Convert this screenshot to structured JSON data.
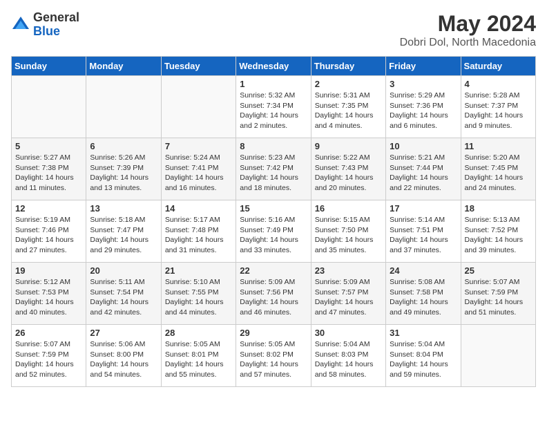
{
  "header": {
    "logo_general": "General",
    "logo_blue": "Blue",
    "month": "May 2024",
    "location": "Dobri Dol, North Macedonia"
  },
  "weekdays": [
    "Sunday",
    "Monday",
    "Tuesday",
    "Wednesday",
    "Thursday",
    "Friday",
    "Saturday"
  ],
  "weeks": [
    [
      {
        "day": "",
        "info": ""
      },
      {
        "day": "",
        "info": ""
      },
      {
        "day": "",
        "info": ""
      },
      {
        "day": "1",
        "info": "Sunrise: 5:32 AM\nSunset: 7:34 PM\nDaylight: 14 hours\nand 2 minutes."
      },
      {
        "day": "2",
        "info": "Sunrise: 5:31 AM\nSunset: 7:35 PM\nDaylight: 14 hours\nand 4 minutes."
      },
      {
        "day": "3",
        "info": "Sunrise: 5:29 AM\nSunset: 7:36 PM\nDaylight: 14 hours\nand 6 minutes."
      },
      {
        "day": "4",
        "info": "Sunrise: 5:28 AM\nSunset: 7:37 PM\nDaylight: 14 hours\nand 9 minutes."
      }
    ],
    [
      {
        "day": "5",
        "info": "Sunrise: 5:27 AM\nSunset: 7:38 PM\nDaylight: 14 hours\nand 11 minutes."
      },
      {
        "day": "6",
        "info": "Sunrise: 5:26 AM\nSunset: 7:39 PM\nDaylight: 14 hours\nand 13 minutes."
      },
      {
        "day": "7",
        "info": "Sunrise: 5:24 AM\nSunset: 7:41 PM\nDaylight: 14 hours\nand 16 minutes."
      },
      {
        "day": "8",
        "info": "Sunrise: 5:23 AM\nSunset: 7:42 PM\nDaylight: 14 hours\nand 18 minutes."
      },
      {
        "day": "9",
        "info": "Sunrise: 5:22 AM\nSunset: 7:43 PM\nDaylight: 14 hours\nand 20 minutes."
      },
      {
        "day": "10",
        "info": "Sunrise: 5:21 AM\nSunset: 7:44 PM\nDaylight: 14 hours\nand 22 minutes."
      },
      {
        "day": "11",
        "info": "Sunrise: 5:20 AM\nSunset: 7:45 PM\nDaylight: 14 hours\nand 24 minutes."
      }
    ],
    [
      {
        "day": "12",
        "info": "Sunrise: 5:19 AM\nSunset: 7:46 PM\nDaylight: 14 hours\nand 27 minutes."
      },
      {
        "day": "13",
        "info": "Sunrise: 5:18 AM\nSunset: 7:47 PM\nDaylight: 14 hours\nand 29 minutes."
      },
      {
        "day": "14",
        "info": "Sunrise: 5:17 AM\nSunset: 7:48 PM\nDaylight: 14 hours\nand 31 minutes."
      },
      {
        "day": "15",
        "info": "Sunrise: 5:16 AM\nSunset: 7:49 PM\nDaylight: 14 hours\nand 33 minutes."
      },
      {
        "day": "16",
        "info": "Sunrise: 5:15 AM\nSunset: 7:50 PM\nDaylight: 14 hours\nand 35 minutes."
      },
      {
        "day": "17",
        "info": "Sunrise: 5:14 AM\nSunset: 7:51 PM\nDaylight: 14 hours\nand 37 minutes."
      },
      {
        "day": "18",
        "info": "Sunrise: 5:13 AM\nSunset: 7:52 PM\nDaylight: 14 hours\nand 39 minutes."
      }
    ],
    [
      {
        "day": "19",
        "info": "Sunrise: 5:12 AM\nSunset: 7:53 PM\nDaylight: 14 hours\nand 40 minutes."
      },
      {
        "day": "20",
        "info": "Sunrise: 5:11 AM\nSunset: 7:54 PM\nDaylight: 14 hours\nand 42 minutes."
      },
      {
        "day": "21",
        "info": "Sunrise: 5:10 AM\nSunset: 7:55 PM\nDaylight: 14 hours\nand 44 minutes."
      },
      {
        "day": "22",
        "info": "Sunrise: 5:09 AM\nSunset: 7:56 PM\nDaylight: 14 hours\nand 46 minutes."
      },
      {
        "day": "23",
        "info": "Sunrise: 5:09 AM\nSunset: 7:57 PM\nDaylight: 14 hours\nand 47 minutes."
      },
      {
        "day": "24",
        "info": "Sunrise: 5:08 AM\nSunset: 7:58 PM\nDaylight: 14 hours\nand 49 minutes."
      },
      {
        "day": "25",
        "info": "Sunrise: 5:07 AM\nSunset: 7:59 PM\nDaylight: 14 hours\nand 51 minutes."
      }
    ],
    [
      {
        "day": "26",
        "info": "Sunrise: 5:07 AM\nSunset: 7:59 PM\nDaylight: 14 hours\nand 52 minutes."
      },
      {
        "day": "27",
        "info": "Sunrise: 5:06 AM\nSunset: 8:00 PM\nDaylight: 14 hours\nand 54 minutes."
      },
      {
        "day": "28",
        "info": "Sunrise: 5:05 AM\nSunset: 8:01 PM\nDaylight: 14 hours\nand 55 minutes."
      },
      {
        "day": "29",
        "info": "Sunrise: 5:05 AM\nSunset: 8:02 PM\nDaylight: 14 hours\nand 57 minutes."
      },
      {
        "day": "30",
        "info": "Sunrise: 5:04 AM\nSunset: 8:03 PM\nDaylight: 14 hours\nand 58 minutes."
      },
      {
        "day": "31",
        "info": "Sunrise: 5:04 AM\nSunset: 8:04 PM\nDaylight: 14 hours\nand 59 minutes."
      },
      {
        "day": "",
        "info": ""
      }
    ]
  ]
}
